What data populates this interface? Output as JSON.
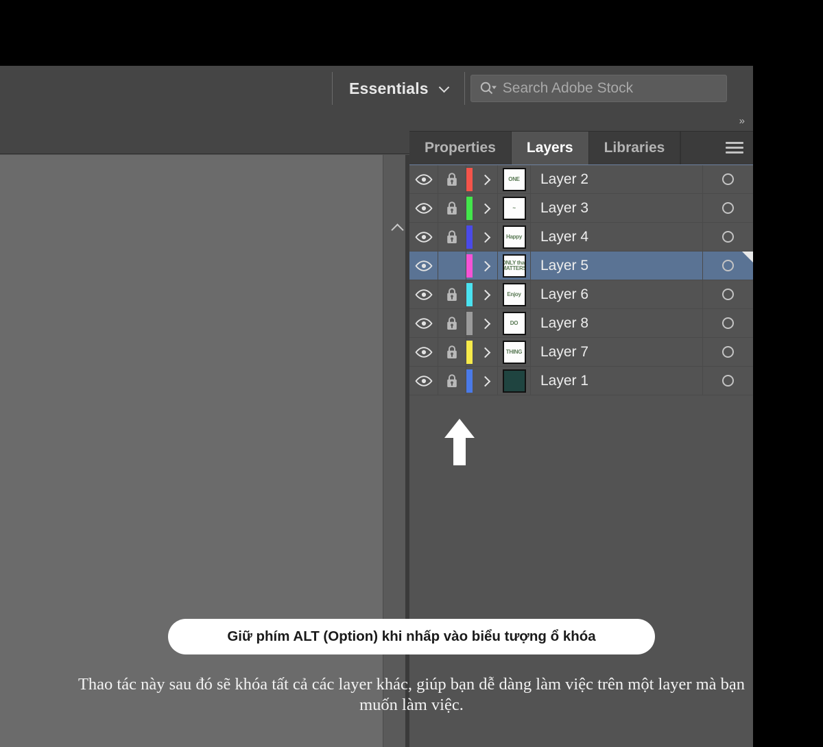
{
  "appbar": {
    "workspace_label": "Essentials",
    "workspace_chevron_icon": "chevron-down-icon",
    "search_icon": "search-stock-icon",
    "search_placeholder": "Search Adobe Stock",
    "search_value": ""
  },
  "canvas": {
    "collapse_icon": "chevron-up-icon"
  },
  "dock": {
    "collapse_panels_icon": "double-chevron-right-icon",
    "collapse_panels_label": "»",
    "menu_icon": "hamburger-menu-icon",
    "tabs": [
      {
        "label": "Properties",
        "active": false
      },
      {
        "label": "Layers",
        "active": true
      },
      {
        "label": "Libraries",
        "active": false
      }
    ]
  },
  "layers_panel": {
    "columns": [
      "visibility",
      "lock",
      "color",
      "expand",
      "thumbnail",
      "name",
      "target"
    ],
    "visibility_icon": "eye-icon",
    "lock_icon": "padlock-closed-icon",
    "expand_icon": "chevron-right-icon",
    "target_icon": "target-circle-icon",
    "rows": [
      {
        "name": "Layer 2",
        "visible": true,
        "locked": true,
        "selected": false,
        "color": "#f4544a",
        "thumb_text": "ONE",
        "thumb_solid": false
      },
      {
        "name": "Layer 3",
        "visible": true,
        "locked": true,
        "selected": false,
        "color": "#43e64b",
        "thumb_text": "~",
        "thumb_solid": false
      },
      {
        "name": "Layer 4",
        "visible": true,
        "locked": true,
        "selected": false,
        "color": "#4a4ae8",
        "thumb_text": "Happy",
        "thumb_solid": false
      },
      {
        "name": "Layer 5",
        "visible": true,
        "locked": false,
        "selected": true,
        "color": "#f553d6",
        "thumb_text": "ONLY that MATTERS",
        "thumb_solid": false
      },
      {
        "name": "Layer 6",
        "visible": true,
        "locked": true,
        "selected": false,
        "color": "#4ae2f0",
        "thumb_text": "Enjoy",
        "thumb_solid": false
      },
      {
        "name": "Layer 8",
        "visible": true,
        "locked": true,
        "selected": false,
        "color": "#9b9b9b",
        "thumb_text": "DO",
        "thumb_solid": false
      },
      {
        "name": "Layer 7",
        "visible": true,
        "locked": true,
        "selected": false,
        "color": "#f6ea4a",
        "thumb_text": "THING",
        "thumb_solid": false
      },
      {
        "name": "Layer 1",
        "visible": true,
        "locked": true,
        "selected": false,
        "color": "#4a7ae8",
        "thumb_text": "",
        "thumb_solid": true
      }
    ]
  },
  "annotations": {
    "arrow_icon": "arrow-up-icon",
    "pill_text": "Giữ phím ALT (Option) khi nhấp vào biểu tượng ổ khóa",
    "caption_text": "Thao tác này sau đó sẽ khóa tất cả các layer khác, giúp bạn dễ dàng làm việc trên một layer mà bạn muốn làm việc."
  },
  "colors": {
    "app_bg": "#535353",
    "bar_bg": "#454545",
    "dock_bg": "#3b3b3b",
    "selection": "#5a7394",
    "text": "#ededed",
    "pill_bg": "#ffffff"
  }
}
